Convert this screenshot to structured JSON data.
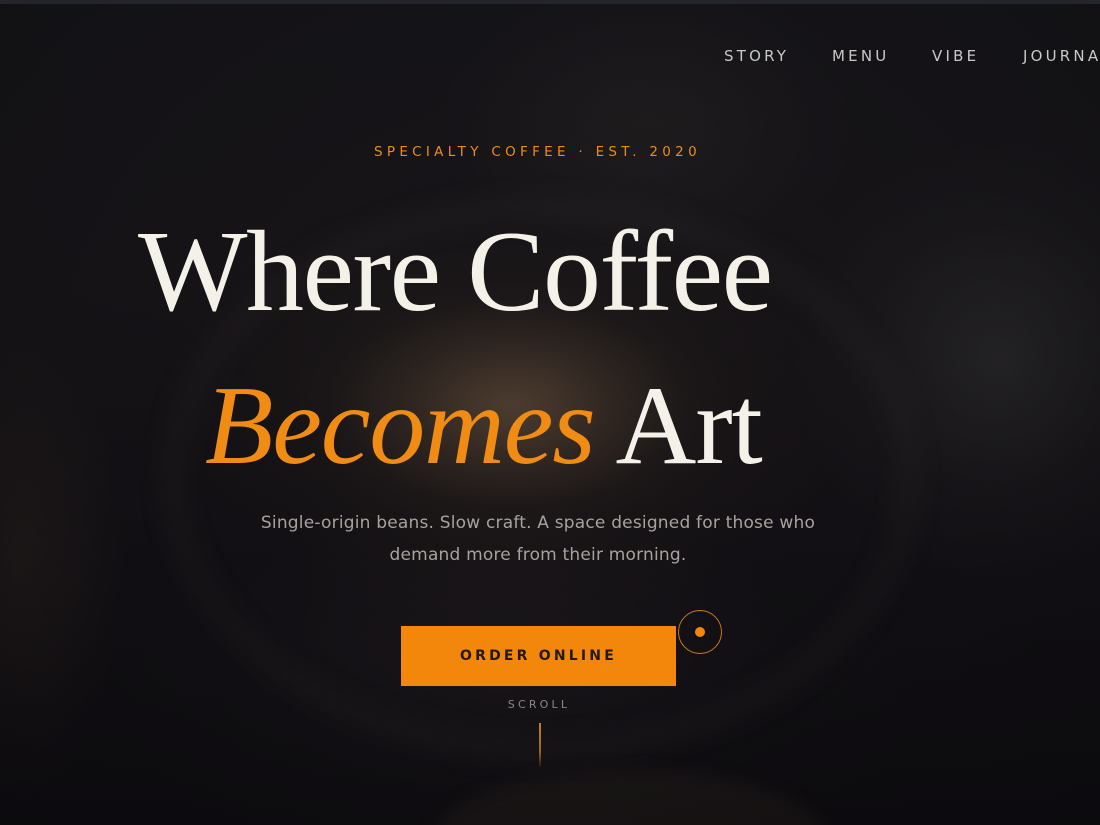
{
  "nav": {
    "items": [
      "STORY",
      "MENU",
      "VIBE",
      "JOURNAL"
    ]
  },
  "hero": {
    "eyebrow": "SPECIALTY COFFEE · EST. 2020",
    "headline": {
      "line1": "Where Coffee",
      "accent": "Becomes",
      "line2_rest": "Art"
    },
    "subtitle": {
      "line1": "Single-origin beans. Slow craft. A space designed for those who",
      "line2": "demand more from their morning."
    },
    "cta_label": "ORDER ONLINE",
    "scroll_label": "SCROLL"
  },
  "colors": {
    "accent": "#f3870c",
    "headline": "#f4f1e8",
    "background": "#121016",
    "nav_text": "#c8c8c8",
    "subtitle": "#a8a29d"
  }
}
